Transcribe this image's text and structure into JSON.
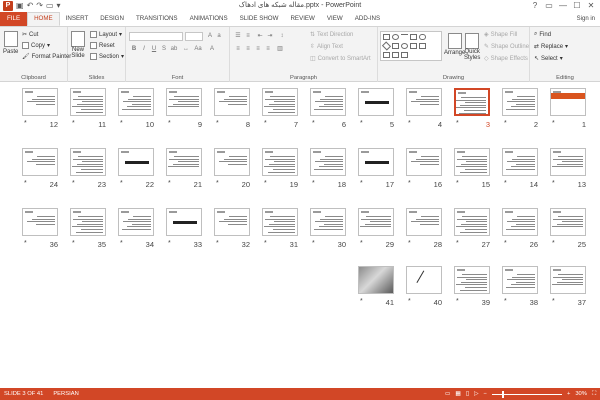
{
  "titlebar": {
    "title": "مقاله شبکه های ادهاک.pptx - PowerPoint",
    "logo": "P",
    "qat": [
      "save-icon",
      "undo-icon",
      "redo-icon",
      "start-icon",
      "customize-icon"
    ],
    "controls": [
      "?",
      "▭",
      "—",
      "☐",
      "✕"
    ]
  },
  "tabs": {
    "items": [
      "FILE",
      "HOME",
      "INSERT",
      "DESIGN",
      "TRANSITIONS",
      "ANIMATIONS",
      "SLIDE SHOW",
      "REVIEW",
      "VIEW",
      "ADD-INS"
    ],
    "active": "HOME",
    "signin": "Sign in"
  },
  "ribbon": {
    "clipboard": {
      "label": "Clipboard",
      "paste": "Paste",
      "cut": "Cut",
      "copy": "Copy",
      "format_painter": "Format Painter"
    },
    "slides": {
      "label": "Slides",
      "new_slide": "New",
      "new_slide2": "Slide",
      "layout": "Layout",
      "reset": "Reset",
      "section": "Section"
    },
    "font": {
      "label": "Font"
    },
    "paragraph": {
      "label": "Paragraph",
      "text_direction": "Text Direction",
      "align_text": "Align Text",
      "convert": "Convert to SmartArt"
    },
    "drawing": {
      "label": "Drawing",
      "arrange": "Arrange",
      "quick_styles": "Quick",
      "quick_styles2": "Styles",
      "shape_fill": "Shape Fill",
      "shape_outline": "Shape Outline",
      "shape_effects": "Shape Effects"
    },
    "editing": {
      "label": "Editing",
      "find": "Find",
      "replace": "Replace",
      "select": "Select"
    }
  },
  "slides": {
    "rows": [
      [
        "12",
        "11",
        "10",
        "9",
        "8",
        "7",
        "6",
        "5",
        "4",
        "3",
        "2",
        "1"
      ],
      [
        "24",
        "23",
        "22",
        "21",
        "20",
        "19",
        "18",
        "17",
        "16",
        "15",
        "14",
        "13"
      ],
      [
        "36",
        "35",
        "34",
        "33",
        "32",
        "31",
        "30",
        "29",
        "28",
        "27",
        "26",
        "25"
      ],
      [
        "41",
        "40",
        "39",
        "38",
        "37"
      ]
    ],
    "star": "*",
    "selected": "3"
  },
  "status": {
    "slide_info": "SLIDE 3 OF 41",
    "language": "PERSIAN",
    "zoom": "30%",
    "zoom_fraction": 0.3
  },
  "colors": {
    "accent": "#d24726"
  }
}
